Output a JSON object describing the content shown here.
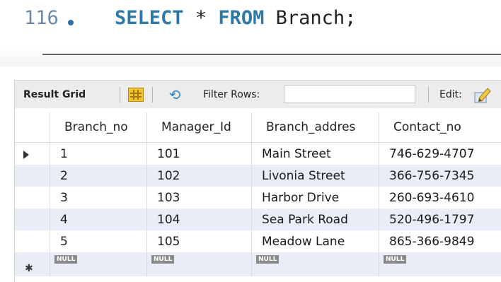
{
  "editor": {
    "line_number": "116",
    "kw_select_1": "SEL",
    "kw_select_2": "ECT",
    "star": " * ",
    "kw_from_1": "FR",
    "kw_from_2": "OM",
    "table_name": " Branch;"
  },
  "toolbar": {
    "result_grid_label": "Result Grid",
    "filter_label": "Filter Rows:",
    "filter_value": "",
    "edit_label": "Edit:"
  },
  "grid": {
    "columns": [
      "Branch_no",
      "Manager_Id",
      "Branch_addres",
      "Contact_no"
    ],
    "rows": [
      [
        "1",
        "101",
        "Main Street",
        "746-629-4707"
      ],
      [
        "2",
        "102",
        "Livonia Street",
        "366-756-7345"
      ],
      [
        "3",
        "103",
        "Harbor Drive",
        "260-693-4610"
      ],
      [
        "4",
        "104",
        "Sea Park Road",
        "520-496-1797"
      ],
      [
        "5",
        "105",
        "Meadow Lane",
        "865-366-9849"
      ]
    ],
    "null_label": "NULL"
  }
}
